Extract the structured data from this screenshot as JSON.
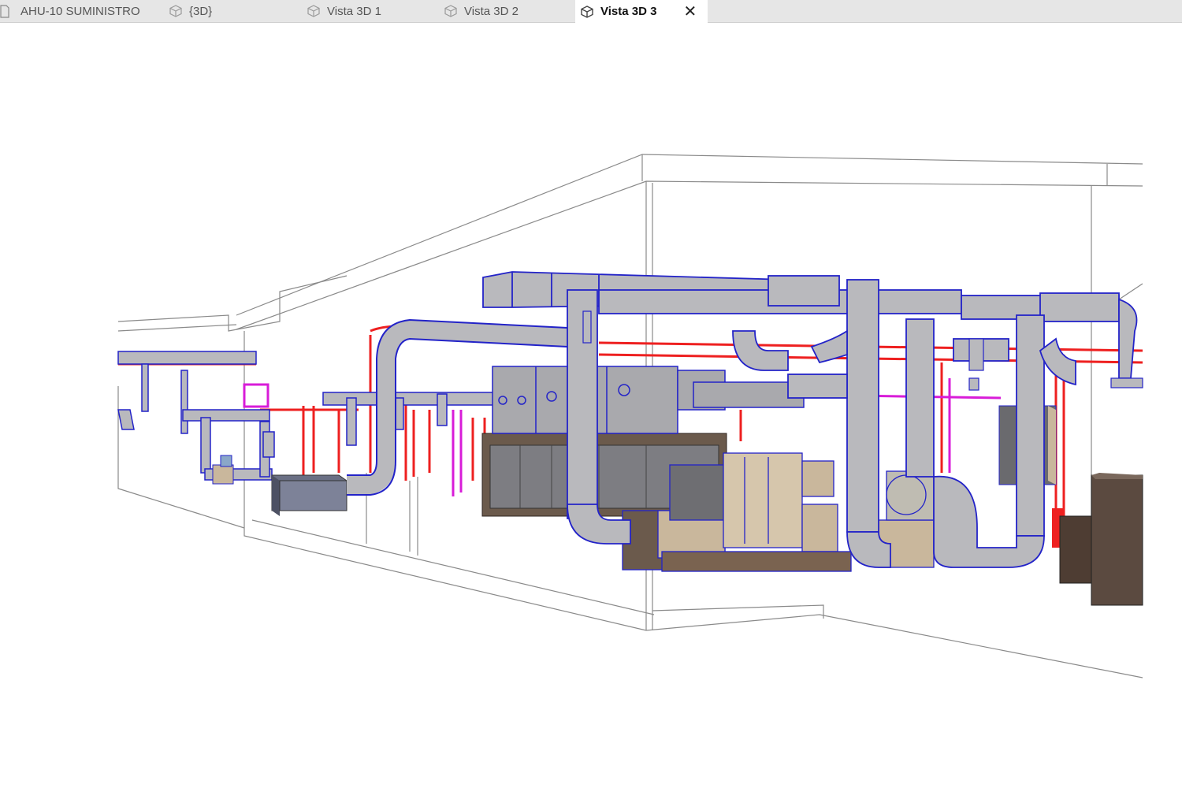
{
  "tabs": [
    {
      "label": "AHU-10 SUMINISTRO",
      "icon": "sheet-icon",
      "active": false
    },
    {
      "label": "{3D}",
      "icon": "cube-view-icon",
      "active": false
    },
    {
      "label": "Vista 3D 1",
      "icon": "cube-view-icon",
      "active": false
    },
    {
      "label": "Vista 3D 2",
      "icon": "cube-view-icon",
      "active": false
    },
    {
      "label": "Vista 3D 3",
      "icon": "cube-view-icon",
      "active": true
    }
  ],
  "close_icon": "close-icon",
  "colors": {
    "duct_fill": "#b9b9bd",
    "duct_edge": "#2323c8",
    "pipe_red": "#ee2020",
    "pipe_magenta": "#d81cd8",
    "equipment_tan": "#c9b79c",
    "equipment_dark": "#5a4a40",
    "wireframe": "#8a8a8a"
  }
}
